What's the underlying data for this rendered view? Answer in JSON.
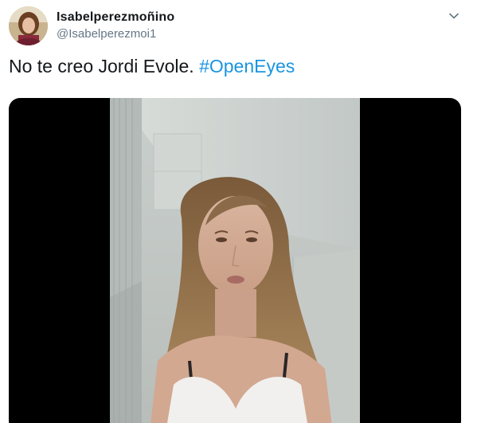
{
  "tweet": {
    "display_name": "Isabelperezmoñino",
    "handle": "@Isabelperezmoi1",
    "text": "No te creo Jordi Evole. ",
    "hashtag": "#OpenEyes"
  },
  "icons": {
    "avatar": "profile-photo",
    "menu": "chevron-down-icon"
  },
  "colors": {
    "name": "#14171a",
    "handle": "#657786",
    "hashtag": "#1b95e0",
    "media_background": "#000000"
  }
}
